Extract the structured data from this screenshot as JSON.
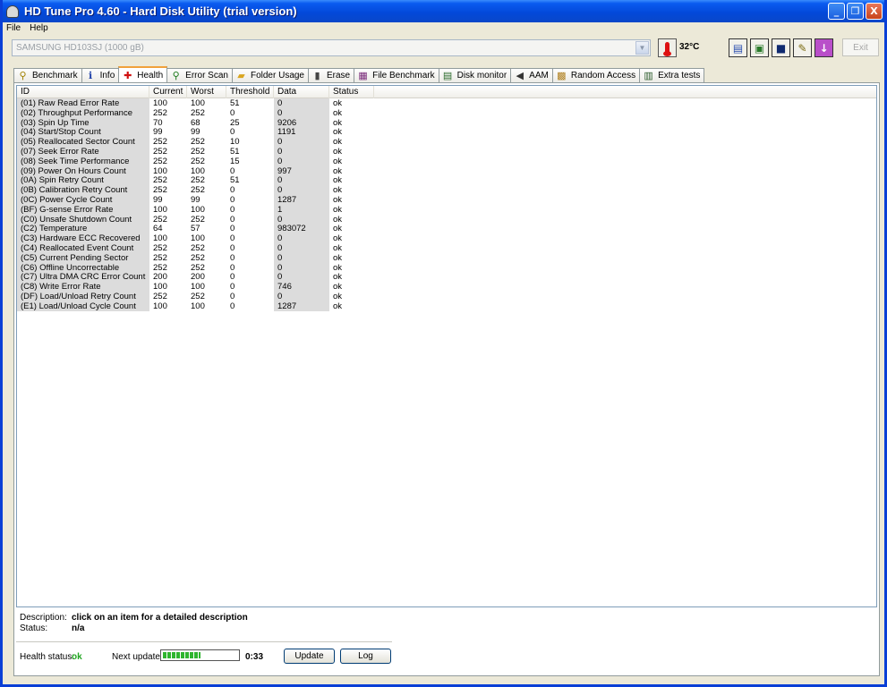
{
  "window": {
    "title": "HD Tune Pro 4.60 - Hard Disk Utility (trial version)",
    "min_glyph": "_",
    "max_glyph": "❐",
    "close_glyph": "X"
  },
  "menu": {
    "file": "File",
    "help": "Help"
  },
  "toolbar": {
    "drive": "SAMSUNG HD103SJ (1000 gB)",
    "temperature": "32°C",
    "exit_label": "Exit"
  },
  "tabs": [
    {
      "label": "Benchmark",
      "icon": "gauge-icon"
    },
    {
      "label": "Info",
      "icon": "info-icon"
    },
    {
      "label": "Health",
      "icon": "health-cross-icon"
    },
    {
      "label": "Error Scan",
      "icon": "magnifier-icon"
    },
    {
      "label": "Folder Usage",
      "icon": "folder-icon"
    },
    {
      "label": "Erase",
      "icon": "trash-icon"
    },
    {
      "label": "File Benchmark",
      "icon": "file-benchmark-icon"
    },
    {
      "label": "Disk monitor",
      "icon": "monitor-icon"
    },
    {
      "label": "AAM",
      "icon": "speaker-icon"
    },
    {
      "label": "Random Access",
      "icon": "random-access-icon"
    },
    {
      "label": "Extra tests",
      "icon": "extra-tests-icon"
    }
  ],
  "active_tab": "Health",
  "table": {
    "headers": [
      "ID",
      "Current",
      "Worst",
      "Threshold",
      "Data",
      "Status"
    ],
    "rows": [
      [
        "(01) Raw Read Error Rate",
        "100",
        "100",
        "51",
        "0",
        "ok"
      ],
      [
        "(02) Throughput Performance",
        "252",
        "252",
        "0",
        "0",
        "ok"
      ],
      [
        "(03) Spin Up Time",
        "70",
        "68",
        "25",
        "9206",
        "ok"
      ],
      [
        "(04) Start/Stop Count",
        "99",
        "99",
        "0",
        "1191",
        "ok"
      ],
      [
        "(05) Reallocated Sector Count",
        "252",
        "252",
        "10",
        "0",
        "ok"
      ],
      [
        "(07) Seek Error Rate",
        "252",
        "252",
        "51",
        "0",
        "ok"
      ],
      [
        "(08) Seek Time Performance",
        "252",
        "252",
        "15",
        "0",
        "ok"
      ],
      [
        "(09) Power On Hours Count",
        "100",
        "100",
        "0",
        "997",
        "ok"
      ],
      [
        "(0A) Spin Retry Count",
        "252",
        "252",
        "51",
        "0",
        "ok"
      ],
      [
        "(0B) Calibration Retry Count",
        "252",
        "252",
        "0",
        "0",
        "ok"
      ],
      [
        "(0C) Power Cycle Count",
        "99",
        "99",
        "0",
        "1287",
        "ok"
      ],
      [
        "(BF) G-sense Error Rate",
        "100",
        "100",
        "0",
        "1",
        "ok"
      ],
      [
        "(C0) Unsafe Shutdown Count",
        "252",
        "252",
        "0",
        "0",
        "ok"
      ],
      [
        "(C2) Temperature",
        "64",
        "57",
        "0",
        "983072",
        "ok"
      ],
      [
        "(C3) Hardware ECC Recovered",
        "100",
        "100",
        "0",
        "0",
        "ok"
      ],
      [
        "(C4) Reallocated Event Count",
        "252",
        "252",
        "0",
        "0",
        "ok"
      ],
      [
        "(C5) Current Pending Sector",
        "252",
        "252",
        "0",
        "0",
        "ok"
      ],
      [
        "(C6) Offline Uncorrectable",
        "252",
        "252",
        "0",
        "0",
        "ok"
      ],
      [
        "(C7) Ultra DMA CRC Error Count",
        "200",
        "200",
        "0",
        "0",
        "ok"
      ],
      [
        "(C8) Write Error Rate",
        "100",
        "100",
        "0",
        "746",
        "ok"
      ],
      [
        "(DF) Load/Unload Retry Count",
        "252",
        "252",
        "0",
        "0",
        "ok"
      ],
      [
        "(E1) Load/Unload Cycle Count",
        "100",
        "100",
        "0",
        "1287",
        "ok"
      ]
    ]
  },
  "details": {
    "description_label": "Description:",
    "description_value": "click on an item for a detailed description",
    "status_label": "Status:",
    "status_value": "n/a"
  },
  "health": {
    "label": "Health status:",
    "value": "ok",
    "next_update_label": "Next update:",
    "progress_fraction": 0.5,
    "timer": "0:33",
    "update_label": "Update",
    "log_label": "Log"
  },
  "colors": {
    "health_ok": "#21a521",
    "progress": "#2fb52f",
    "active_tab_accent": "#f1a13b",
    "titlebar": "#0348d8"
  }
}
